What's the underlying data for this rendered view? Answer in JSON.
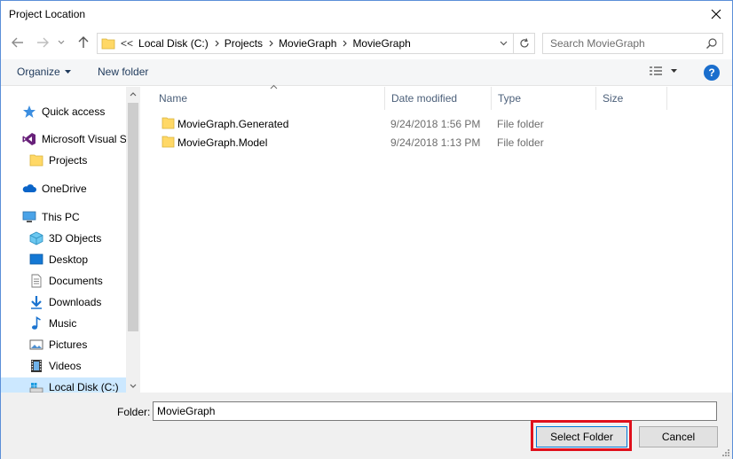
{
  "window": {
    "title": "Project Location"
  },
  "address": {
    "overflow": "<<",
    "crumbs": [
      "Local Disk (C:)",
      "Projects",
      "MovieGraph",
      "MovieGraph"
    ]
  },
  "search": {
    "placeholder": "Search MovieGraph"
  },
  "toolbar": {
    "organize_label": "Organize",
    "new_folder_label": "New folder",
    "help_label": "?"
  },
  "nav_pane": {
    "items": [
      {
        "label": "Quick access",
        "icon": "star-icon"
      },
      {
        "label": "Microsoft Visual S",
        "icon": "visual-studio-icon"
      },
      {
        "label": "Projects",
        "icon": "folder-icon"
      },
      {
        "label": "OneDrive",
        "icon": "cloud-icon"
      },
      {
        "label": "This PC",
        "icon": "computer-icon"
      },
      {
        "label": "3D Objects",
        "icon": "cube-icon"
      },
      {
        "label": "Desktop",
        "icon": "desktop-icon"
      },
      {
        "label": "Documents",
        "icon": "document-icon"
      },
      {
        "label": "Downloads",
        "icon": "download-icon"
      },
      {
        "label": "Music",
        "icon": "music-icon"
      },
      {
        "label": "Pictures",
        "icon": "pictures-icon"
      },
      {
        "label": "Videos",
        "icon": "video-icon"
      },
      {
        "label": "Local Disk (C:)",
        "icon": "drive-icon",
        "selected": true
      }
    ]
  },
  "file_list": {
    "columns": [
      "Name",
      "Date modified",
      "Type",
      "Size"
    ],
    "rows": [
      {
        "name": "MovieGraph.Generated",
        "date": "9/24/2018 1:56 PM",
        "type": "File folder",
        "size": ""
      },
      {
        "name": "MovieGraph.Model",
        "date": "9/24/2018 1:13 PM",
        "type": "File folder",
        "size": ""
      }
    ]
  },
  "bottom": {
    "folder_label": "Folder:",
    "folder_value": "MovieGraph",
    "select_label": "Select Folder",
    "cancel_label": "Cancel"
  },
  "colors": {
    "accent": "#0078d7",
    "highlight": "#e0101c",
    "folder": "#ffd866",
    "selection": "#cce8ff"
  }
}
